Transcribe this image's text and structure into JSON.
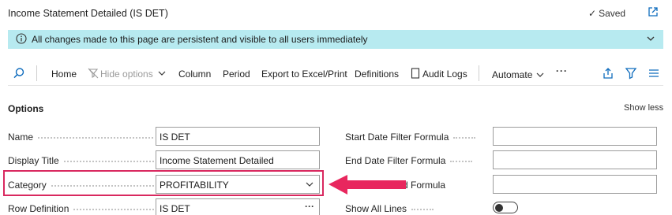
{
  "window": {
    "title": "Income Statement Detailed (IS DET)",
    "saved_label": "Saved"
  },
  "banner": {
    "message": "All changes made to this page are persistent and visible to all users immediately"
  },
  "toolbar": {
    "home": "Home",
    "hide_options": "Hide options",
    "column": "Column",
    "period": "Period",
    "export": "Export to Excel/Print",
    "definitions": "Definitions",
    "audit_logs": "Audit Logs",
    "automate": "Automate",
    "more": "···"
  },
  "options": {
    "heading": "Options",
    "show_less": "Show less"
  },
  "fields": {
    "name": {
      "label": "Name",
      "value": "IS DET"
    },
    "display_title": {
      "label": "Display Title",
      "value": "Income Statement Detailed"
    },
    "category": {
      "label": "Category",
      "value": "PROFITABILITY"
    },
    "row_definition": {
      "label": "Row Definition",
      "value": "IS DET"
    },
    "start_date": {
      "label": "Start Date Filter Formula",
      "value": ""
    },
    "end_date": {
      "label": "End Date Filter Formula",
      "value": ""
    },
    "date_formula": {
      "label": "d Formula",
      "value": ""
    },
    "show_all_lines": {
      "label": "Show All Lines",
      "value": "off"
    }
  },
  "colors": {
    "banner": "#b7eaf0",
    "highlight": "#d9285f",
    "accent": "#0f6cbd"
  }
}
